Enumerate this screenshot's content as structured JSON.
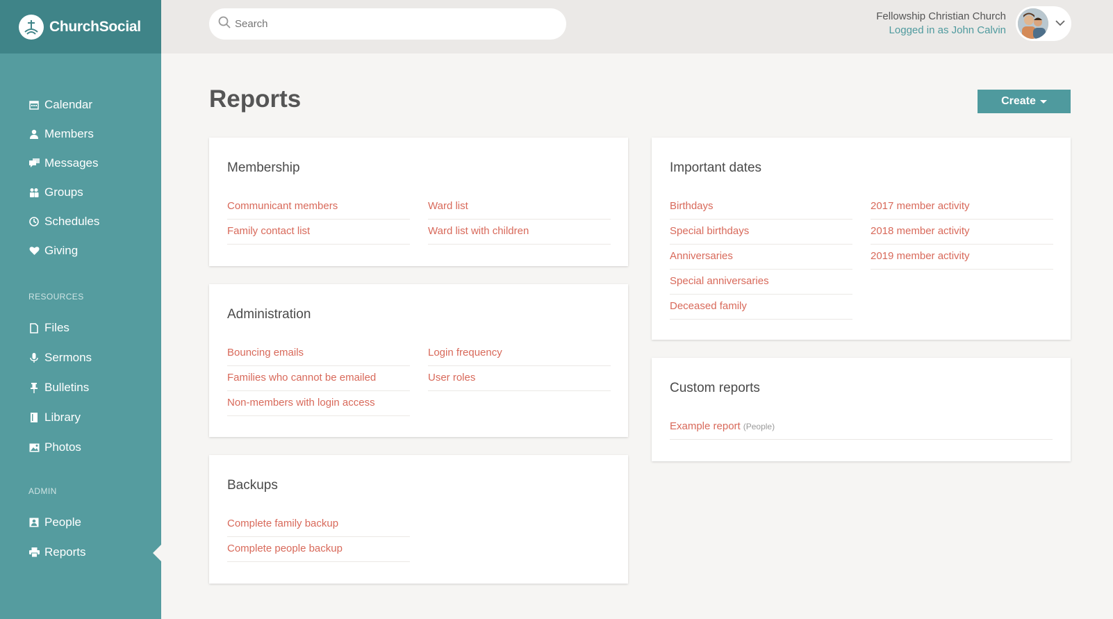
{
  "brand": {
    "name": "ChurchSocial"
  },
  "search": {
    "placeholder": "Search"
  },
  "user": {
    "church": "Fellowship Christian Church",
    "logged_in": "Logged in as John Calvin"
  },
  "nav": {
    "main": [
      {
        "label": "Calendar",
        "icon": "calendar-icon"
      },
      {
        "label": "Members",
        "icon": "person-icon"
      },
      {
        "label": "Messages",
        "icon": "chat-icon"
      },
      {
        "label": "Groups",
        "icon": "group-icon"
      },
      {
        "label": "Schedules",
        "icon": "clock-icon"
      },
      {
        "label": "Giving",
        "icon": "heart-icon"
      }
    ],
    "resources_heading": "RESOURCES",
    "resources": [
      {
        "label": "Files",
        "icon": "file-icon"
      },
      {
        "label": "Sermons",
        "icon": "microphone-icon"
      },
      {
        "label": "Bulletins",
        "icon": "pin-icon"
      },
      {
        "label": "Library",
        "icon": "book-icon"
      },
      {
        "label": "Photos",
        "icon": "image-icon"
      }
    ],
    "admin_heading": "ADMIN",
    "admin": [
      {
        "label": "People",
        "icon": "contact-icon"
      },
      {
        "label": "Reports",
        "icon": "printer-icon",
        "active": true
      }
    ]
  },
  "page": {
    "title": "Reports",
    "create_label": "Create"
  },
  "cards": {
    "membership": {
      "title": "Membership",
      "col1": [
        "Communicant members",
        "Family contact list"
      ],
      "col2": [
        "Ward list",
        "Ward list with children"
      ]
    },
    "administration": {
      "title": "Administration",
      "col1": [
        "Bouncing emails",
        "Families who cannot be emailed",
        "Non-members with login access"
      ],
      "col2": [
        "Login frequency",
        "User roles"
      ]
    },
    "backups": {
      "title": "Backups",
      "col1": [
        "Complete family backup",
        "Complete people backup"
      ]
    },
    "important_dates": {
      "title": "Important dates",
      "col1": [
        "Birthdays",
        "Special birthdays",
        "Anniversaries",
        "Special anniversaries",
        "Deceased family"
      ],
      "col2": [
        "2017 member activity",
        "2018 member activity",
        "2019 member activity"
      ]
    },
    "custom": {
      "title": "Custom reports",
      "items": [
        {
          "label": "Example report",
          "tag": "(People)"
        }
      ]
    }
  },
  "colors": {
    "sidebar": "#559c9f",
    "brand_bar": "#3f8488",
    "accent": "#4f9a9e",
    "link": "#d8695a"
  }
}
